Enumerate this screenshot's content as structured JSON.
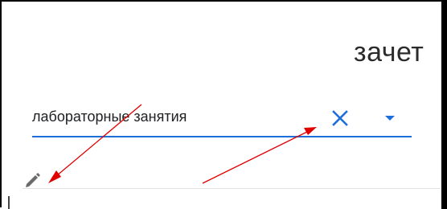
{
  "assessment": {
    "type_label": "зачет"
  },
  "field": {
    "value": "лабораторные занятия",
    "clear_icon": "close-icon",
    "dropdown_icon": "caret-down-icon",
    "underline_color": "#1e6fd9",
    "icon_color": "#1e6fd9"
  },
  "row": {
    "edit_icon": "pencil-icon"
  },
  "annotations": {
    "arrow_color": "#e00000",
    "arrow_count": 2
  }
}
